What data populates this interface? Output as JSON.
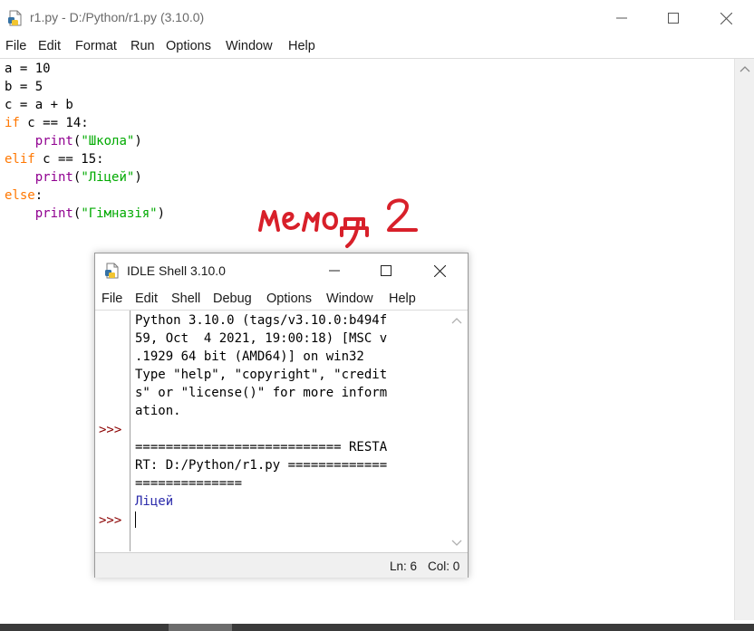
{
  "editor": {
    "title": "r1.py - D:/Python/r1.py (3.10.0)",
    "menu": [
      "File",
      "Edit",
      "Format",
      "Run",
      "Options",
      "Window",
      "Help"
    ],
    "code": {
      "l1": "a = 10",
      "l2": "b = 5",
      "l3": "c = a + b",
      "l4_kw": "if",
      "l4_rest": " c == 14:",
      "l5_fn": "print",
      "l5_open": "(",
      "l5_str": "\"Школа\"",
      "l5_close": ")",
      "l6_kw": "elif",
      "l6_rest": " c == 15:",
      "l7_fn": "print",
      "l7_open": "(",
      "l7_str": "\"Ліцей\"",
      "l7_close": ")",
      "l8_kw": "else",
      "l8_rest": ":",
      "l9_fn": "print",
      "l9_open": "(",
      "l9_str": "\"Гімназія\"",
      "l9_close": ")"
    }
  },
  "annotation": {
    "handwritten_text": "метод 2",
    "color": "#d8202a"
  },
  "shell": {
    "title": "IDLE Shell 3.10.0",
    "menu": [
      "File",
      "Edit",
      "Shell",
      "Debug",
      "Options",
      "Window",
      "Help"
    ],
    "prompt": ">>>",
    "banner": [
      "Python 3.10.0 (tags/v3.10.0:b494f",
      "59, Oct  4 2021, 19:00:18) [MSC v",
      ".1929 64 bit (AMD64)] on win32",
      "Type \"help\", \"copyright\", \"credit",
      "s\" or \"license()\" for more inform",
      "ation."
    ],
    "restart": [
      "=========================== RESTA",
      "RT: D:/Python/r1.py =============",
      "=============="
    ],
    "output": "Ліцей",
    "status": {
      "ln": "Ln: 6",
      "col": "Col: 0"
    }
  },
  "colors": {
    "keyword": "#ff7700",
    "builtin": "#900090",
    "string": "#00aa00",
    "prompt": "#8b0000",
    "stdout": "#2b2bab"
  },
  "icons": [
    "python-file-icon",
    "minimize-icon",
    "maximize-icon",
    "close-icon",
    "scroll-up-arrow-icon",
    "scroll-down-arrow-icon"
  ]
}
